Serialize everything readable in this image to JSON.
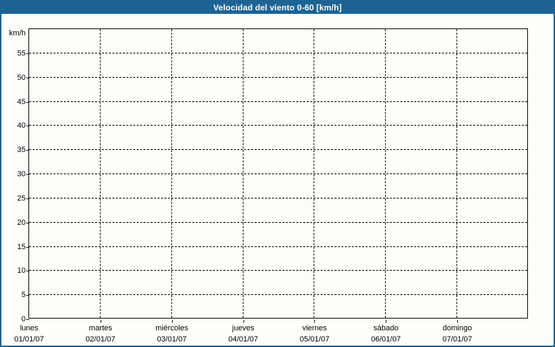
{
  "title_bar": {
    "title": "Velocidad del viento 0-60 [km/h]"
  },
  "chart_data": {
    "type": "line",
    "title": "Velocidad del viento 0-60 [km/h]",
    "ylabel": "km/h",
    "xlabel": "",
    "ylim": [
      0,
      60
    ],
    "ytick_step": 5,
    "ytick_labels": [
      "0",
      "5",
      "10",
      "15",
      "20",
      "25",
      "30",
      "35",
      "40",
      "45",
      "50",
      "55"
    ],
    "grid": "dashed, both axes",
    "legend_position": "none",
    "categories": [
      {
        "day": "lunes",
        "date": "01/01/07"
      },
      {
        "day": "martes",
        "date": "02/01/07"
      },
      {
        "day": "miércoles",
        "date": "03/01/07"
      },
      {
        "day": "jueves",
        "date": "04/01/07"
      },
      {
        "day": "viernes",
        "date": "05/01/07"
      },
      {
        "day": "sábado",
        "date": "06/01/07"
      },
      {
        "day": "domingo",
        "date": "07/01/07"
      }
    ],
    "series": []
  },
  "colors": {
    "title_bar_bg": "#1D6394",
    "frame_border": "#1D6394",
    "title_text": "#FFFFFF",
    "background": "#FDFEFA",
    "axis": "#000000",
    "grid": "#000000",
    "label_text": "#000000"
  }
}
